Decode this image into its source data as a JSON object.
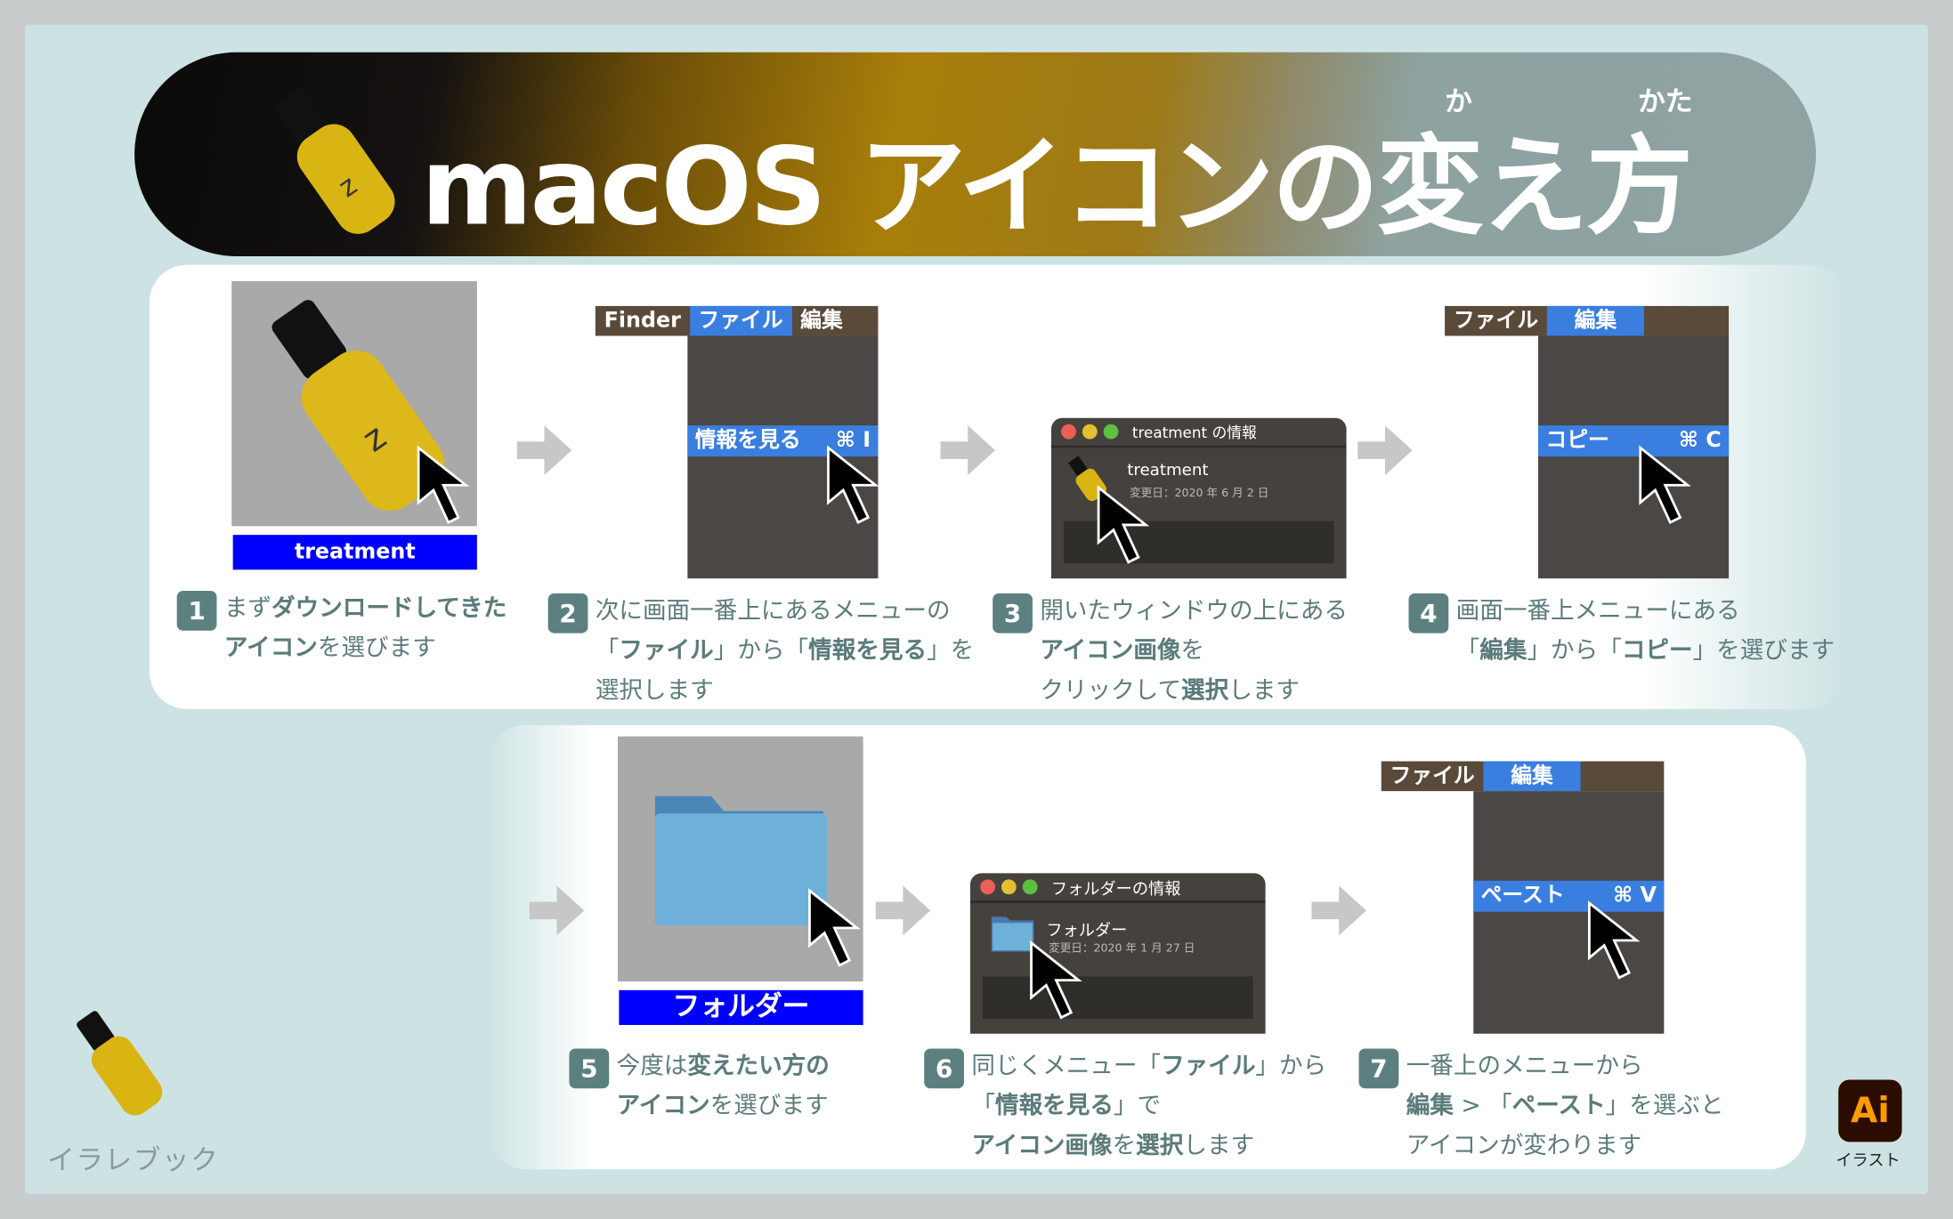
{
  "title": {
    "main": "macOS アイコンの変え方",
    "ruby_ka": "か",
    "ruby_kata": "かた"
  },
  "colors": {
    "background": "#cde3e3",
    "selection_blue": "#0000ff",
    "menu_highlight": "#3a7ee0",
    "badge": "#5c8080",
    "caption_text": "#5c7b7b"
  },
  "steps": [
    {
      "num": "1",
      "image_label": "treatment",
      "caption": [
        [
          "まず",
          ""
        ],
        [
          "ダウンロードしてきた",
          "b"
        ],
        [
          "|",
          ""
        ],
        [
          "アイコン",
          "b"
        ],
        [
          "を選びます",
          ""
        ]
      ]
    },
    {
      "num": "2",
      "menubar": [
        "Finder",
        "ファイル",
        "編集"
      ],
      "menu_item": "情報を見る",
      "shortcut": "⌘ I",
      "caption": [
        [
          "次に画面一番上にあるメニューの",
          ""
        ],
        [
          "|",
          ""
        ],
        [
          "「",
          ""
        ],
        [
          "ファイル",
          "b"
        ],
        [
          "」から「",
          ""
        ],
        [
          "情報を見る",
          "b"
        ],
        [
          "」を",
          ""
        ],
        [
          "|",
          ""
        ],
        [
          "選択します",
          ""
        ]
      ]
    },
    {
      "num": "3",
      "window": {
        "title": "treatment の情報",
        "name": "treatment",
        "date": "変更日：2020 年 6 月 2 日"
      },
      "caption": [
        [
          "開いたウィンドウの上にある",
          ""
        ],
        [
          "|",
          ""
        ],
        [
          "アイコン画像",
          "b"
        ],
        [
          "を",
          ""
        ],
        [
          "|",
          ""
        ],
        [
          "クリックして",
          ""
        ],
        [
          "選択",
          "b"
        ],
        [
          "します",
          ""
        ]
      ]
    },
    {
      "num": "4",
      "menubar": [
        "ファイル",
        "編集"
      ],
      "menu_item": "コピー",
      "shortcut": "⌘ C",
      "caption": [
        [
          "画面一番上メニューにある",
          ""
        ],
        [
          "|",
          ""
        ],
        [
          "「",
          ""
        ],
        [
          "編集",
          "b"
        ],
        [
          "」から「",
          ""
        ],
        [
          "コピー",
          "b"
        ],
        [
          "」を選びます",
          ""
        ]
      ]
    },
    {
      "num": "5",
      "image_label": "フォルダー",
      "caption": [
        [
          "今度は",
          ""
        ],
        [
          "変えたい方の",
          "b"
        ],
        [
          "|",
          ""
        ],
        [
          "アイコン",
          "b"
        ],
        [
          "を選びます",
          ""
        ]
      ]
    },
    {
      "num": "6",
      "window": {
        "title": "フォルダーの情報",
        "name": "フォルダー",
        "date": "変更日：2020 年 1 月 27 日"
      },
      "caption": [
        [
          "同じくメニュー「",
          ""
        ],
        [
          "ファイル",
          "b"
        ],
        [
          "」から",
          ""
        ],
        [
          "|",
          ""
        ],
        [
          "「",
          ""
        ],
        [
          "情報を見る",
          "b"
        ],
        [
          "」で",
          ""
        ],
        [
          "|",
          ""
        ],
        [
          "アイコン画像",
          "b"
        ],
        [
          "を",
          ""
        ],
        [
          "選択",
          "b"
        ],
        [
          "します",
          ""
        ]
      ]
    },
    {
      "num": "7",
      "menubar": [
        "ファイル",
        "編集"
      ],
      "menu_item": "ペースト",
      "shortcut": "⌘ V",
      "caption": [
        [
          "一番上のメニューから",
          ""
        ],
        [
          "|",
          ""
        ],
        [
          "編集",
          "b"
        ],
        [
          " > 「",
          ""
        ],
        [
          "ペースト",
          "b"
        ],
        [
          "」を選ぶと",
          ""
        ],
        [
          "|",
          ""
        ],
        [
          "アイコンが変わります",
          ""
        ]
      ]
    }
  ],
  "logo": {
    "text": "イラレブック"
  },
  "app_badge": {
    "icon": "Ai",
    "label": "イラスト"
  }
}
